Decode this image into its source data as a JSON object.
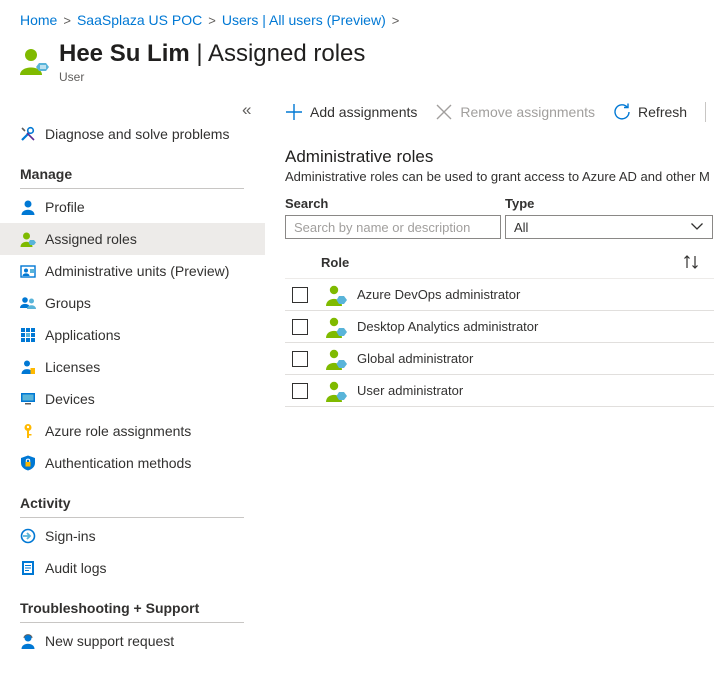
{
  "breadcrumb": [
    {
      "label": "Home"
    },
    {
      "label": "SaaSplaza US POC"
    },
    {
      "label": "Users | All users (Preview)"
    }
  ],
  "header": {
    "user_name": "Hee Su Lim",
    "separator": " | ",
    "page_name": "Assigned roles",
    "subtitle": "User"
  },
  "sidebar": {
    "collapse_glyph": "«",
    "top_item": {
      "label": "Diagnose and solve problems",
      "icon": "wrench-icon"
    },
    "sections": [
      {
        "title": "Manage",
        "items": [
          {
            "label": "Profile",
            "icon": "user-icon"
          },
          {
            "label": "Assigned roles",
            "icon": "user-role-icon",
            "active": true
          },
          {
            "label": "Administrative units (Preview)",
            "icon": "admin-units-icon"
          },
          {
            "label": "Groups",
            "icon": "groups-icon"
          },
          {
            "label": "Applications",
            "icon": "applications-icon"
          },
          {
            "label": "Licenses",
            "icon": "licenses-icon"
          },
          {
            "label": "Devices",
            "icon": "devices-icon"
          },
          {
            "label": "Azure role assignments",
            "icon": "key-icon"
          },
          {
            "label": "Authentication methods",
            "icon": "shield-icon"
          }
        ]
      },
      {
        "title": "Activity",
        "items": [
          {
            "label": "Sign-ins",
            "icon": "sign-in-icon"
          },
          {
            "label": "Audit logs",
            "icon": "audit-log-icon"
          }
        ]
      },
      {
        "title": "Troubleshooting + Support",
        "items": [
          {
            "label": "New support request",
            "icon": "support-user-icon"
          }
        ]
      }
    ]
  },
  "toolbar": {
    "add_label": "Add assignments",
    "remove_label": "Remove assignments",
    "refresh_label": "Refresh"
  },
  "main": {
    "title": "Administrative roles",
    "description": "Administrative roles can be used to grant access to Azure AD and other M",
    "search_label": "Search",
    "search_placeholder": "Search by name or description",
    "type_label": "Type",
    "type_value": "All"
  },
  "table": {
    "column_role": "Role",
    "rows": [
      {
        "role": "Azure DevOps administrator"
      },
      {
        "role": "Desktop Analytics administrator"
      },
      {
        "role": "Global administrator"
      },
      {
        "role": "User administrator"
      }
    ]
  },
  "colors": {
    "link": "#0078d4",
    "user_green": "#7fba00",
    "active_bg": "#edebe9"
  }
}
